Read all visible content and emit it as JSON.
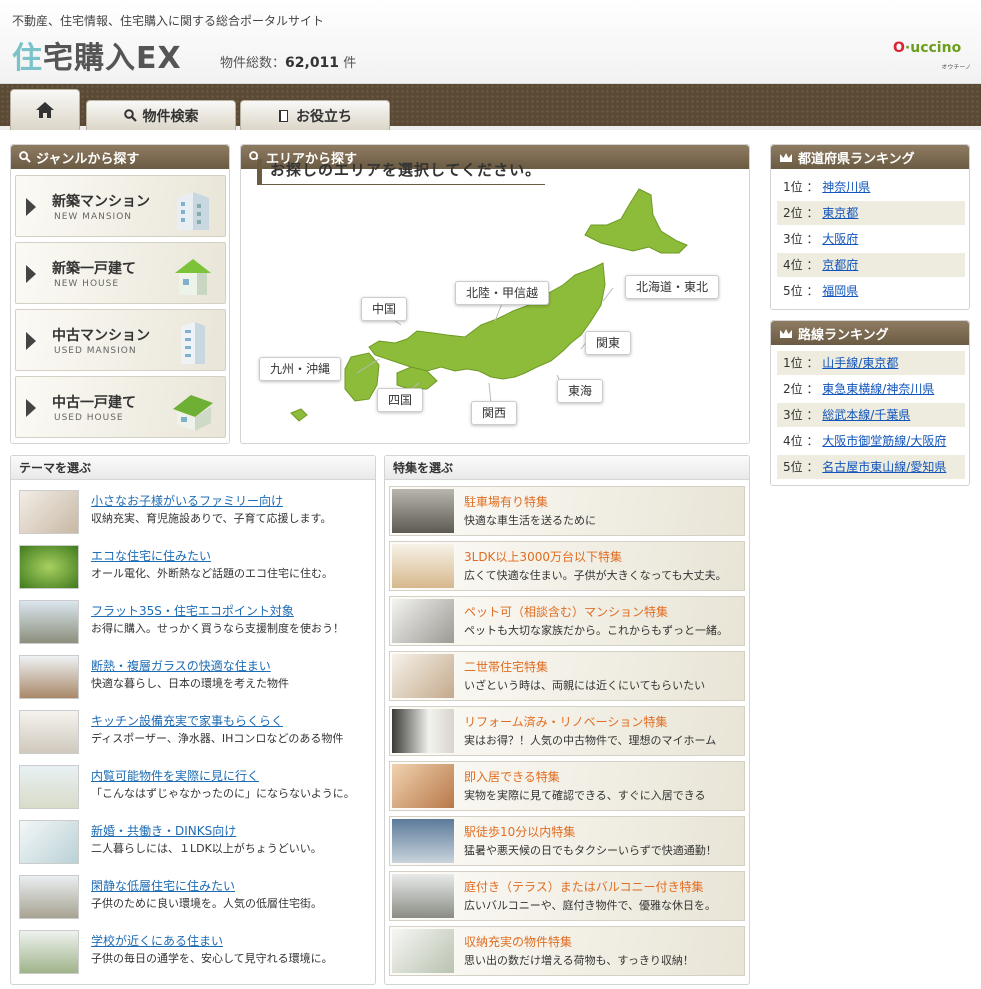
{
  "header": {
    "tagline": "不動産、住宅情報、住宅購入に関する総合ポータルサイト",
    "logo_first": "住",
    "logo_rest": "宅購入EX",
    "count_label": "物件総数：",
    "count_value": "62,011",
    "count_unit": "件",
    "brand_o": "O",
    "brand_rest": "uccino",
    "brand_sub": "オウチーノ"
  },
  "nav": {
    "home_icon": "house-icon",
    "tabs": [
      {
        "label": "物件検索",
        "icon": "search-icon"
      },
      {
        "label": "お役立ち",
        "icon": "book-icon"
      }
    ]
  },
  "genre": {
    "title": "ジャンルから探す",
    "items": [
      {
        "ja": "新築マンション",
        "en": "NEW MANSION"
      },
      {
        "ja": "新築一戸建て",
        "en": "NEW HOUSE"
      },
      {
        "ja": "中古マンション",
        "en": "USED MANSION"
      },
      {
        "ja": "中古一戸建て",
        "en": "USED HOUSE"
      }
    ]
  },
  "area": {
    "title": "エリアから探す",
    "prompt": "お探しのエリアを選択してください。",
    "regions": [
      "北海道・東北",
      "北陸・甲信越",
      "中国",
      "関東",
      "九州・沖縄",
      "東海",
      "四国",
      "関西"
    ]
  },
  "pref_rank": {
    "title": "都道府県ランキング",
    "items": [
      {
        "rank": "1位",
        "name": "神奈川県"
      },
      {
        "rank": "2位",
        "name": "東京都"
      },
      {
        "rank": "3位",
        "name": "大阪府"
      },
      {
        "rank": "4位",
        "name": "京都府"
      },
      {
        "rank": "5位",
        "name": "福岡県"
      }
    ]
  },
  "line_rank": {
    "title": "路線ランキング",
    "items": [
      {
        "rank": "1位",
        "name": "山手線/東京都"
      },
      {
        "rank": "2位",
        "name": "東急東横線/神奈川県"
      },
      {
        "rank": "3位",
        "name": "総武本線/千葉県"
      },
      {
        "rank": "4位",
        "name": "大阪市御堂筋線/大阪府"
      },
      {
        "rank": "5位",
        "name": "名古屋市東山線/愛知県"
      }
    ]
  },
  "theme": {
    "title": "テーマを選ぶ",
    "items": [
      {
        "title": "小さなお子様がいるファミリー向け",
        "desc": "収納充実、育児施設ありで、子育て応援します。"
      },
      {
        "title": "エコな住宅に住みたい",
        "desc": "オール電化、外断熱など話題のエコ住宅に住む。"
      },
      {
        "title": "フラット35S・住宅エコポイント対象",
        "desc": "お得に購入。せっかく買うなら支援制度を使おう！"
      },
      {
        "title": "断熱・複層ガラスの快適な住まい",
        "desc": "快適な暮らし、日本の環境を考えた物件"
      },
      {
        "title": "キッチン設備充実で家事もらくらく",
        "desc": "ディスポーザー、浄水器、IHコンロなどのある物件"
      },
      {
        "title": "内覧可能物件を実際に見に行く",
        "desc": "「こんなはずじゃなかったのに」にならないように。"
      },
      {
        "title": "新婚・共働き・DINKS向け",
        "desc": "二人暮らしには、１LDK以上がちょうどいい。"
      },
      {
        "title": "閑静な低層住宅に住みたい",
        "desc": "子供のために良い環境を。人気の低層住宅街。"
      },
      {
        "title": "学校が近くにある住まい",
        "desc": "子供の毎日の通学を、安心して見守れる環境に。"
      }
    ]
  },
  "feature": {
    "title": "特集を選ぶ",
    "items": [
      {
        "title": "駐車場有り特集",
        "desc": "快適な車生活を送るために"
      },
      {
        "title": "3LDK以上3000万台以下特集",
        "desc": "広くて快適な住まい。子供が大きくなっても大丈夫。"
      },
      {
        "title": "ペット可（相談含む）マンション特集",
        "desc": "ペットも大切な家族だから。これからもずっと一緒。"
      },
      {
        "title": "二世帯住宅特集",
        "desc": "いざという時は、両親には近くにいてもらいたい"
      },
      {
        "title": "リフォーム済み・リノベーション特集",
        "desc": "実はお得？！人気の中古物件で、理想のマイホーム"
      },
      {
        "title": "即入居できる特集",
        "desc": "実物を実際に見て確認できる、すぐに入居できる"
      },
      {
        "title": "駅徒歩10分以内特集",
        "desc": "猛暑や悪天候の日でもタクシーいらずで快適通勤！"
      },
      {
        "title": "庭付き（テラス）またはバルコニー付き特集",
        "desc": "広いバルコニーや、庭付き物件で、優雅な休日を。"
      },
      {
        "title": "収納充実の物件特集",
        "desc": "思い出の数だけ増える荷物も、すっきり収納！"
      }
    ]
  },
  "colors": {
    "header_brown": "#6b5b43",
    "map_green": "#8dbb3a",
    "feature_orange": "#e06d21",
    "link_blue": "#1155bb"
  }
}
